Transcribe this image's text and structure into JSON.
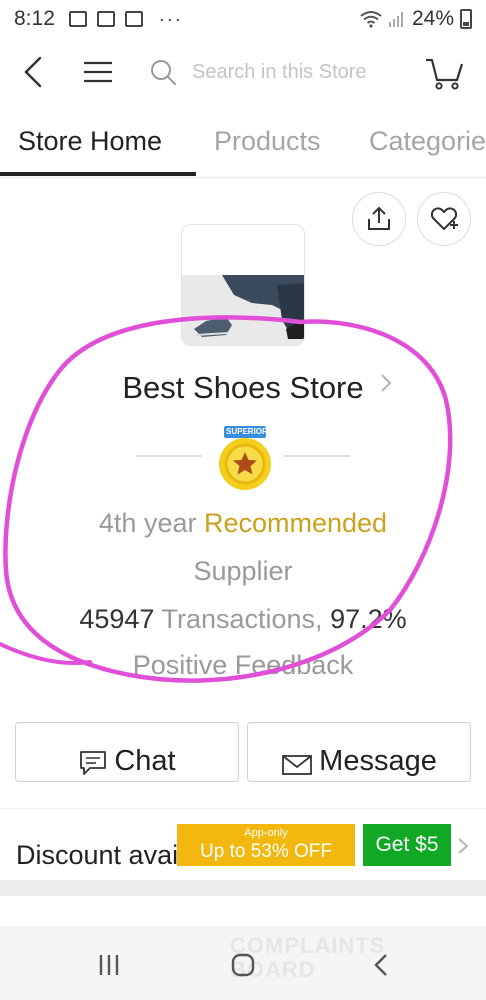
{
  "status_bar": {
    "time": "8:12",
    "dots": "···",
    "battery": "24%"
  },
  "nav": {
    "search_placeholder": "Search in this Store"
  },
  "tabs": [
    {
      "label": "Store Home",
      "active": true
    },
    {
      "label": "Products",
      "active": false
    },
    {
      "label": "Categories",
      "active": false
    }
  ],
  "store": {
    "name": "Best Shoes Store",
    "badge": "SUPERIOR",
    "years": "4th year",
    "recommended": "Recommended",
    "supplier": "Supplier",
    "transactions_count": "45947",
    "transactions_label": "Transactions,",
    "positive_pct": "97.2%",
    "positive_label": "Positive Feedback"
  },
  "actions": {
    "chat": "Chat",
    "message": "Message"
  },
  "discount": {
    "text": "Discount available",
    "promo_small": "App-only",
    "promo_big": "Up to 53% OFF",
    "get_label": "Get $5"
  },
  "watermark": {
    "line1": "COMPLAINTS",
    "line2": "BOARD"
  },
  "colors": {
    "accent_gold": "#c9a31d",
    "promo_yellow": "#f2b80f",
    "get_green": "#11a825",
    "annotation_magenta": "#e14fd8"
  }
}
